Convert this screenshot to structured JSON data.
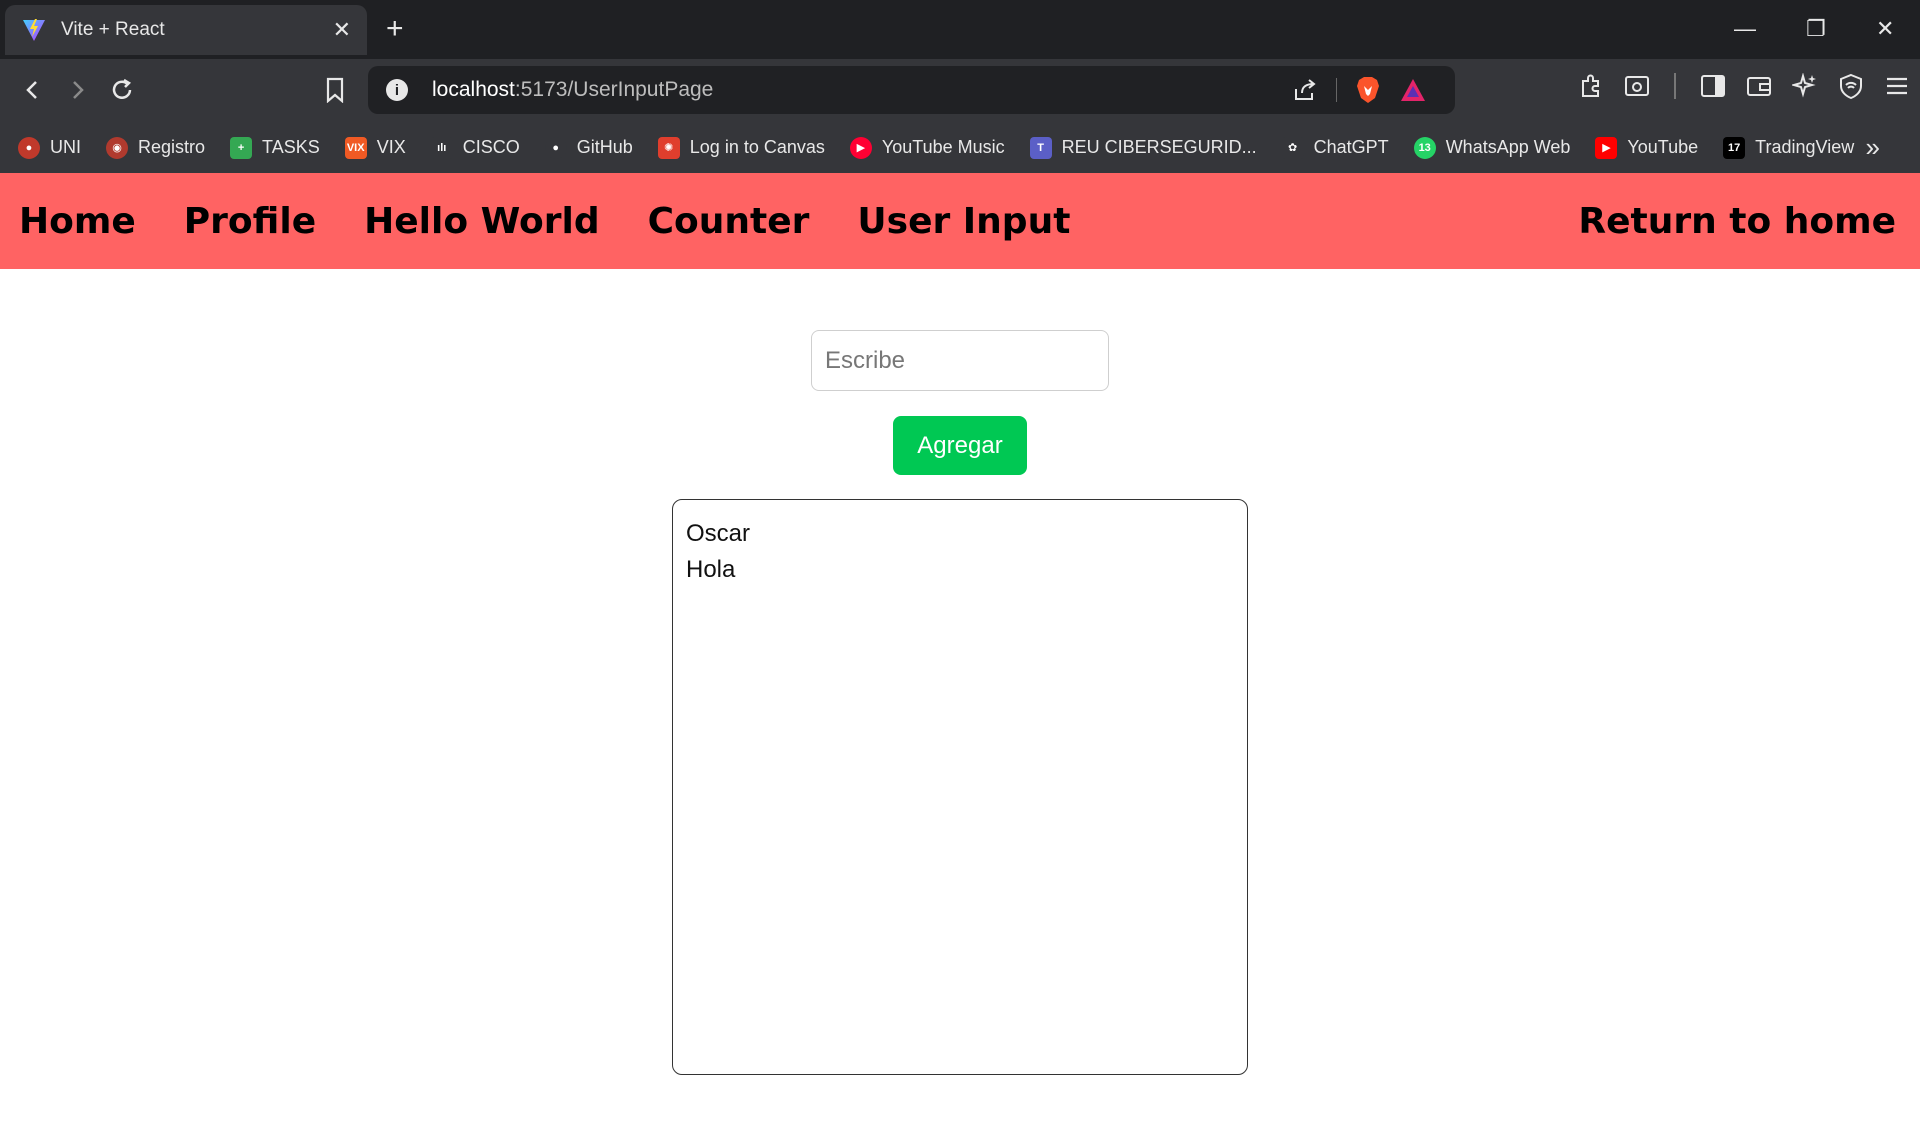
{
  "browser": {
    "tab": {
      "title": "Vite + React"
    },
    "url": {
      "host": "localhost",
      "path": ":5173/UserInputPage"
    },
    "bookmarks": [
      {
        "label": "UNI",
        "icon": "uni-icon",
        "color": "#c0392b"
      },
      {
        "label": "Registro",
        "icon": "registro-icon",
        "color": "#b03a2e"
      },
      {
        "label": "TASKS",
        "icon": "tasks-icon",
        "color": "#34a853"
      },
      {
        "label": "VIX",
        "icon": "vix-icon",
        "color": "#f05a24"
      },
      {
        "label": "CISCO",
        "icon": "cisco-icon",
        "color": "#35363a"
      },
      {
        "label": "GitHub",
        "icon": "github-icon",
        "color": "#35363a"
      },
      {
        "label": "Log in to Canvas",
        "icon": "canvas-icon",
        "color": "#e03e2d"
      },
      {
        "label": "YouTube Music",
        "icon": "youtube-music-icon",
        "color": "#ff0033"
      },
      {
        "label": "REU CIBERSEGURID...",
        "icon": "teams-icon",
        "color": "#5b5fc7"
      },
      {
        "label": "ChatGPT",
        "icon": "chatgpt-icon",
        "color": "#35363a"
      },
      {
        "label": "WhatsApp Web",
        "icon": "whatsapp-icon",
        "color": "#25d366"
      },
      {
        "label": "YouTube",
        "icon": "youtube-icon",
        "color": "#ff0000"
      },
      {
        "label": "TradingView",
        "icon": "tradingview-icon",
        "color": "#000000"
      }
    ]
  },
  "nav": {
    "home": "Home",
    "profile": "Profile",
    "hello_world": "Hello World",
    "counter": "Counter",
    "user_input": "User Input",
    "return_home": "Return to home",
    "bg_color": "#ff6363"
  },
  "form": {
    "placeholder": "Escribe",
    "value": "",
    "button_label": "Agregar",
    "button_color": "#00c853"
  },
  "list": {
    "items": [
      "Oscar",
      "Hola"
    ]
  }
}
